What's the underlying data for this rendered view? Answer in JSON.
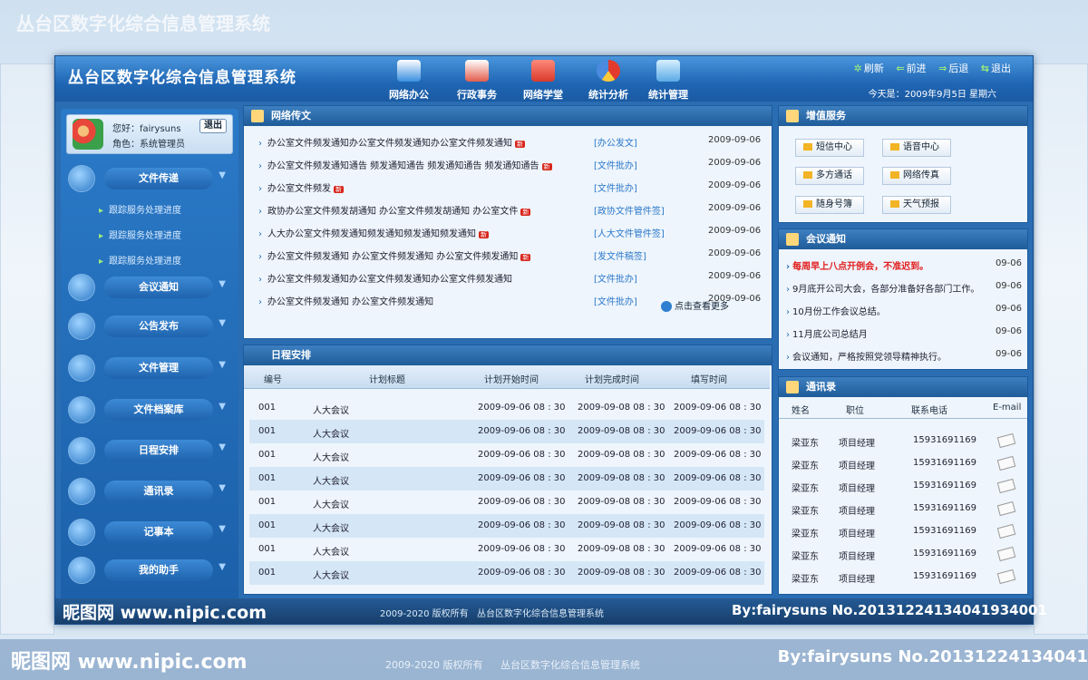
{
  "app": {
    "title": "丛台区数字化综合信息管理系统",
    "nav": [
      {
        "label": "网络办公",
        "icon": "office-icon",
        "color": "#3a8fe0"
      },
      {
        "label": "行政事务",
        "icon": "admin-icon",
        "color": "#e35c4b"
      },
      {
        "label": "网络学堂",
        "icon": "books-icon",
        "color": "#d83a2c"
      },
      {
        "label": "统计分析",
        "icon": "chart-icon",
        "color": "#4a8adf"
      },
      {
        "label": "统计管理",
        "icon": "monitor-icon",
        "color": "#5aa9e6"
      }
    ],
    "toolbar": {
      "refresh": "刷新",
      "forward": "前进",
      "back": "后退",
      "exit": "退出"
    },
    "date": "今天是：2009年9月5日   星期六"
  },
  "user": {
    "greeting": "您好：fairysuns",
    "role": "角色：系统管理员",
    "logout": "退出"
  },
  "menu": [
    {
      "label": "文件传递",
      "icon": "file-transfer-icon"
    },
    {
      "label": "会议通知",
      "icon": "meeting-icon"
    },
    {
      "label": "公告发布",
      "icon": "announce-icon"
    },
    {
      "label": "文件管理",
      "icon": "file-manage-icon"
    },
    {
      "label": "文件档案库",
      "icon": "archive-icon"
    },
    {
      "label": "日程安排",
      "icon": "schedule-icon"
    },
    {
      "label": "通讯录",
      "icon": "contacts-icon"
    },
    {
      "label": "记事本",
      "icon": "notebook-icon"
    },
    {
      "label": "我的助手",
      "icon": "assistant-icon"
    }
  ],
  "submenu": [
    "跟踪服务处理进度",
    "跟踪服务处理进度",
    "跟踪服务处理进度"
  ],
  "news": {
    "title": "网络传文",
    "rows": [
      {
        "text": "办公室文件频发通知办公室文件频发通知办公室文件频发通知",
        "isNew": true,
        "cat": "[办公发文]",
        "date": "2009-09-06"
      },
      {
        "text": "办公室文件频发通知通告  频发通知通告  频发通知通告  频发通知通告",
        "isNew": true,
        "cat": "[文件批办]",
        "date": "2009-09-06"
      },
      {
        "text": "办公室文件频发",
        "isNew": true,
        "cat": "[文件批办]",
        "date": "2009-09-06"
      },
      {
        "text": "政协办公室文件频发胡通知  办公室文件频发胡通知  办公室文件",
        "isNew": true,
        "cat": "[政协文件管件签]",
        "date": "2009-09-06"
      },
      {
        "text": "人大办公室文件频发通知频发通知频发通知频发通知",
        "isNew": true,
        "cat": "[人大文件管件签]",
        "date": "2009-09-06"
      },
      {
        "text": "办公室文件频发通知  办公室文件频发通知  办公室文件频发通知",
        "isNew": true,
        "cat": "[发文件稿签]",
        "date": "2009-09-06"
      },
      {
        "text": "办公室文件频发通知办公室文件频发通知办公室文件频发通知",
        "isNew": false,
        "cat": "[文件批办]",
        "date": "2009-09-06"
      },
      {
        "text": "办公室文件频发通知  办公室文件频发通知",
        "isNew": false,
        "cat": "[文件批办]",
        "date": "2009-09-06"
      }
    ],
    "newBadge": "新",
    "more": "点击查看更多"
  },
  "schedule": {
    "title": "日程安排",
    "headers": [
      "编号",
      "计划标题",
      "计划开始时间",
      "计划完成时间",
      "填写时间"
    ],
    "rows": [
      {
        "id": "001",
        "title": "人大会议",
        "start": "2009-09-06   08 : 30",
        "end": "2009-09-08  08 : 30",
        "filled": "2009-09-06   08 : 30"
      },
      {
        "id": "001",
        "title": "人大会议",
        "start": "2009-09-06   08 : 30",
        "end": "2009-09-08  08 : 30",
        "filled": "2009-09-06   08 : 30"
      },
      {
        "id": "001",
        "title": "人大会议",
        "start": "2009-09-06   08 : 30",
        "end": "2009-09-08  08 : 30",
        "filled": "2009-09-06   08 : 30"
      },
      {
        "id": "001",
        "title": "人大会议",
        "start": "2009-09-06   08 : 30",
        "end": "2009-09-08  08 : 30",
        "filled": "2009-09-06   08 : 30"
      },
      {
        "id": "001",
        "title": "人大会议",
        "start": "2009-09-06   08 : 30",
        "end": "2009-09-08  08 : 30",
        "filled": "2009-09-06   08 : 30"
      },
      {
        "id": "001",
        "title": "人大会议",
        "start": "2009-09-06   08 : 30",
        "end": "2009-09-08  08 : 30",
        "filled": "2009-09-06   08 : 30"
      },
      {
        "id": "001",
        "title": "人大会议",
        "start": "2009-09-06   08 : 30",
        "end": "2009-09-08  08 : 30",
        "filled": "2009-09-06   08 : 30"
      },
      {
        "id": "001",
        "title": "人大会议",
        "start": "2009-09-06   08 : 30",
        "end": "2009-09-08  08 : 30",
        "filled": "2009-09-06   08 : 30"
      }
    ]
  },
  "services": {
    "title": "增值服务",
    "buttons": [
      "短信中心",
      "语音中心",
      "多方通话",
      "网络传真",
      "随身号簿",
      "天气预报"
    ]
  },
  "meetings": {
    "title": "会议通知",
    "rows": [
      {
        "text": "每周早上八点开例会，不准迟到。",
        "date": "09-06",
        "urgent": true
      },
      {
        "text": "9月底开公司大会，各部分准备好各部门工作。",
        "date": "09-06",
        "urgent": false
      },
      {
        "text": "10月份工作会议总结。",
        "date": "09-06",
        "urgent": false
      },
      {
        "text": "11月底公司总结月",
        "date": "09-06",
        "urgent": false
      },
      {
        "text": "会议通知，严格按照党领导精神执行。",
        "date": "09-06",
        "urgent": false
      }
    ]
  },
  "contacts": {
    "title": "通讯录",
    "headers": [
      "姓名",
      "职位",
      "联系电话",
      "E-mail"
    ],
    "rows": [
      {
        "name": "梁亚东",
        "pos": "项目经理",
        "phone": "15931691169"
      },
      {
        "name": "梁亚东",
        "pos": "项目经理",
        "phone": "15931691169"
      },
      {
        "name": "梁亚东",
        "pos": "项目经理",
        "phone": "15931691169"
      },
      {
        "name": "梁亚东",
        "pos": "项目经理",
        "phone": "15931691169"
      },
      {
        "name": "梁亚东",
        "pos": "项目经理",
        "phone": "15931691169"
      },
      {
        "name": "梁亚东",
        "pos": "项目经理",
        "phone": "15931691169"
      },
      {
        "name": "梁亚东",
        "pos": "项目经理",
        "phone": "15931691169"
      }
    ]
  },
  "footer": {
    "nipic": "昵图网 www.nipic.com",
    "copyright": "2009-2020  版权所有",
    "system": "丛台区数字化综合信息管理系统",
    "by": "By:fairysuns  No.20131224134041934001"
  },
  "background": {
    "by": "By:fairysuns  No.20131224134041"
  }
}
